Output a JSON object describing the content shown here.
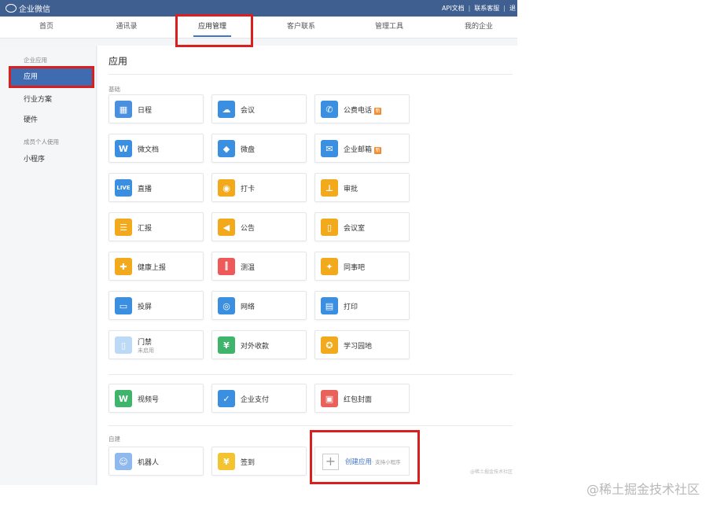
{
  "header": {
    "logo_text": "企业微信",
    "api_docs": "API文档",
    "support": "联系客服",
    "more": "退"
  },
  "nav": {
    "tabs": [
      {
        "label": "首页"
      },
      {
        "label": "通讯录"
      },
      {
        "label": "应用管理"
      },
      {
        "label": "客户联系"
      },
      {
        "label": "管理工具"
      },
      {
        "label": "我的企业"
      }
    ],
    "active": "应用管理"
  },
  "sidebar": {
    "group1": "企业应用",
    "items": [
      {
        "label": "应用"
      },
      {
        "label": "行业方案"
      },
      {
        "label": "硬件"
      }
    ],
    "group2": "成员个人使用",
    "items2": [
      {
        "label": "小程序"
      }
    ]
  },
  "main": {
    "title": "应用",
    "basic_label": "基础",
    "basic_apps": [
      {
        "label": "日程",
        "icon": "calendar-icon",
        "color": "#4a8fe0"
      },
      {
        "label": "会议",
        "icon": "cloud-meeting-icon",
        "color": "#3b8fe0"
      },
      {
        "label": "公费电话",
        "icon": "phone-icon",
        "color": "#3b8fe0",
        "badge": "新"
      },
      {
        "label": "微文档",
        "icon": "w-doc-icon",
        "color": "#3b8fe0"
      },
      {
        "label": "微盘",
        "icon": "drive-icon",
        "color": "#3b8fe0"
      },
      {
        "label": "企业邮箱",
        "icon": "mail-icon",
        "color": "#3b8fe0",
        "badge": "新"
      },
      {
        "label": "直播",
        "icon": "live-icon",
        "color": "#3b8fe0",
        "glyph": "LIVE"
      },
      {
        "label": "打卡",
        "icon": "location-icon",
        "color": "#f2a91b"
      },
      {
        "label": "审批",
        "icon": "stamp-icon",
        "color": "#f2a91b"
      },
      {
        "label": "汇报",
        "icon": "report-icon",
        "color": "#f2a91b"
      },
      {
        "label": "公告",
        "icon": "megaphone-icon",
        "color": "#f2a91b"
      },
      {
        "label": "会议室",
        "icon": "door-icon",
        "color": "#f2a91b"
      },
      {
        "label": "健康上报",
        "icon": "health-icon",
        "color": "#f2a91b"
      },
      {
        "label": "测温",
        "icon": "thermometer-icon",
        "color": "#ee5a5a"
      },
      {
        "label": "同事吧",
        "icon": "colleague-icon",
        "color": "#f2a91b"
      },
      {
        "label": "投屏",
        "icon": "cast-icon",
        "color": "#3b8fe0"
      },
      {
        "label": "网络",
        "icon": "wifi-icon",
        "color": "#3b8fe0"
      },
      {
        "label": "打印",
        "icon": "printer-icon",
        "color": "#3b8fe0"
      },
      {
        "label": "门禁",
        "icon": "access-card-icon",
        "color": "#bcd9f5",
        "sub": "未启用"
      },
      {
        "label": "对外收款",
        "icon": "payment-icon",
        "color": "#3fb46b"
      },
      {
        "label": "学习园地",
        "icon": "study-icon",
        "color": "#f2a91b"
      }
    ],
    "extra_apps": [
      {
        "label": "视频号",
        "icon": "video-channel-icon",
        "color": "#3fb46b"
      },
      {
        "label": "企业支付",
        "icon": "enterprise-pay-icon",
        "color": "#3b8fe0"
      },
      {
        "label": "红包封面",
        "icon": "red-packet-icon",
        "color": "#e8615a"
      }
    ],
    "self_built_label": "自建",
    "self_apps": [
      {
        "label": "机器人",
        "icon": "robot-icon",
        "color": "#8fb9ee"
      },
      {
        "label": "签到",
        "icon": "checkin-icon",
        "color": "#f4c430"
      }
    ],
    "create": {
      "label": "创建应用",
      "hint": "· 支持小程序"
    },
    "watermark": "@稀土掘金技术社区"
  },
  "page_watermark": "@稀土掘金技术社区"
}
